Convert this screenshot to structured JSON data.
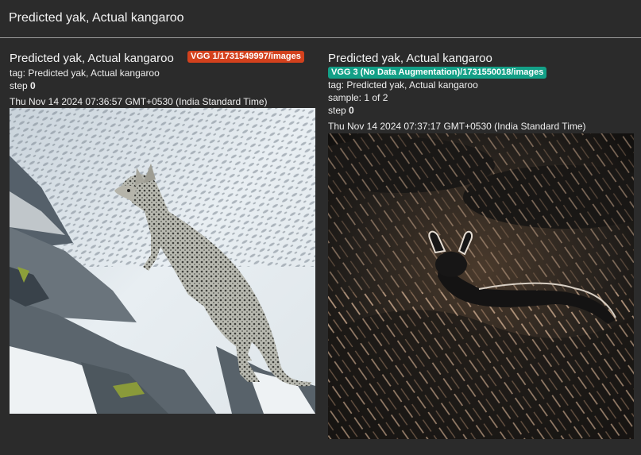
{
  "header": {
    "title": "Predicted yak, Actual kangaroo"
  },
  "cards": [
    {
      "title": "Predicted yak, Actual kangaroo",
      "run": "VGG 1/1731549997/images",
      "run_color": "#d3411d",
      "tag_line": "tag: Predicted yak, Actual kangaroo",
      "step_label": "step",
      "step_value": "0",
      "timestamp": "Thu Nov 14 2024 07:36:57 GMT+0530 (India Standard Time)"
    },
    {
      "title": "Predicted yak, Actual kangaroo",
      "run": "VGG 3 (No Data Augmentation)/1731550018/images",
      "run_color": "#13a087",
      "tag_line": "tag: Predicted yak, Actual kangaroo",
      "sample_line": "sample: 1 of 2",
      "step_label": "step",
      "step_value": "0",
      "timestamp": "Thu Nov 14 2024 07:37:17 GMT+0530 (India Standard Time)"
    }
  ]
}
